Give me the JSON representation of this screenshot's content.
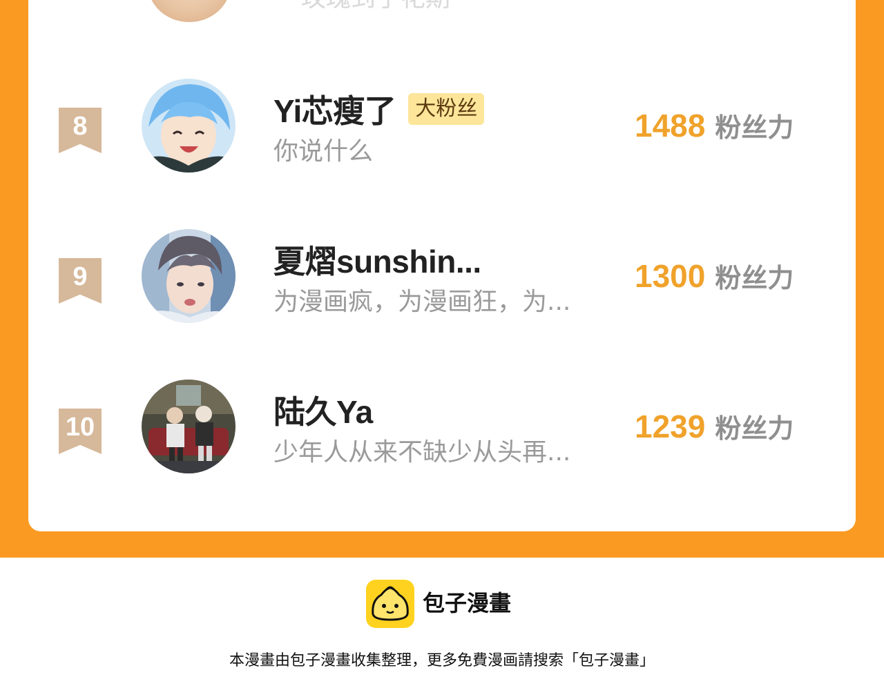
{
  "previous_row": {
    "signature": "玫瑰到了花期"
  },
  "rankings": [
    {
      "rank": "8",
      "username": "Yi芯瘦了",
      "badge": "大粉丝",
      "signature": "你说什么",
      "score": "1488",
      "score_unit": "粉丝力"
    },
    {
      "rank": "9",
      "username": "夏熠sunshin...",
      "badge": "",
      "signature": "为漫画疯，为漫画狂，为...",
      "score": "1300",
      "score_unit": "粉丝力"
    },
    {
      "rank": "10",
      "username": "陆久Ya",
      "badge": "",
      "signature": "少年人从来不缺少从头再...",
      "score": "1239",
      "score_unit": "粉丝力"
    }
  ],
  "footer": {
    "brand": "包子漫畫",
    "note": "本漫畫由包子漫畫收集整理，更多免費漫画請搜索「包子漫畫」"
  },
  "colors": {
    "background_orange": "#fb9a22",
    "score": "#f0a22b",
    "rank_badge": "#d6b89a",
    "fan_badge": "#fde59a",
    "logo_yellow": "#ffd21f"
  },
  "icons": {
    "logo": "bun-face-logo"
  }
}
